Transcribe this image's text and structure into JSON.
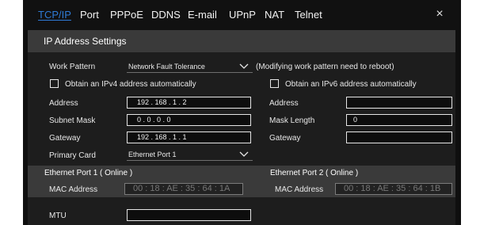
{
  "tabs": [
    {
      "label": "TCP/IP",
      "active": true
    },
    {
      "label": "Port"
    },
    {
      "label": "PPPoE"
    },
    {
      "label": "DDNS"
    },
    {
      "label": "E-mail"
    },
    {
      "label": "UPnP"
    },
    {
      "label": "NAT"
    },
    {
      "label": "Telnet"
    }
  ],
  "close_label": "×",
  "section_title": "IP Address Settings",
  "work_pattern": {
    "label": "Work Pattern",
    "value": "Network Fault Tolerance",
    "note": "(Modifying work pattern need to reboot)"
  },
  "ipv4": {
    "obtain_label": "Obtain an IPv4 address automatically",
    "address_label": "Address",
    "address_value": "192 . 168 .   1 .   2",
    "subnet_label": "Subnet Mask",
    "subnet_value": "0  .   0  .   0  .   0",
    "gateway_label": "Gateway",
    "gateway_value": "192 . 168 .   1 .   1",
    "primary_card_label": "Primary Card",
    "primary_card_value": "Ethernet Port 1"
  },
  "ipv6": {
    "obtain_label": "Obtain an IPv6 address automatically",
    "address_label": "Address",
    "address_value": "",
    "mask_label": "Mask Length",
    "mask_value": "0",
    "gateway_label": "Gateway",
    "gateway_value": ""
  },
  "port1": {
    "title": "Ethernet Port 1 ( Online )",
    "mac_label": "MAC Address",
    "mac_value": "00 : 18 : AE : 35 : 64 : 1A"
  },
  "port2": {
    "title": "Ethernet Port 2 ( Online )",
    "mac_label": "MAC Address",
    "mac_value": "00 : 18 : AE : 35 : 64 : 1B"
  },
  "mtu": {
    "label": "MTU",
    "value": ""
  },
  "colors": {
    "accent": "#2e7bd6",
    "window_bg": "#0f0f0f",
    "panel_bg": "#1d1d1d",
    "band_bg": "#3a3a3a"
  },
  "icons": {
    "close": "close-icon",
    "dropdown": "chevron-down-icon"
  }
}
